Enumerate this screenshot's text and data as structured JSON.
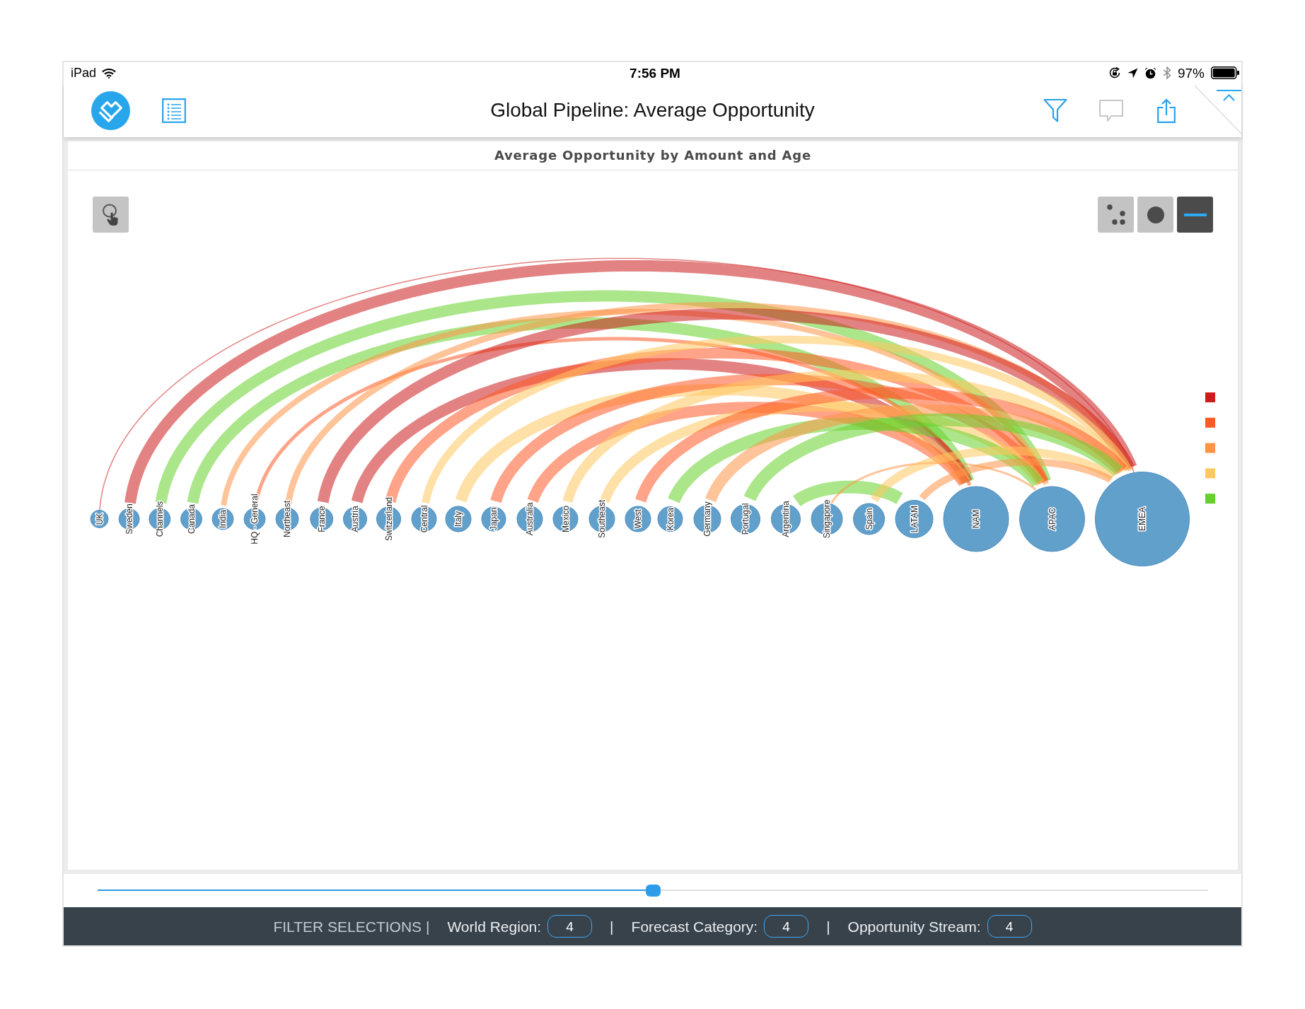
{
  "status_bar": {
    "carrier": "iPad",
    "time": "7:56 PM",
    "battery": "97%"
  },
  "nav_bar": {
    "title": "Global Pipeline: Average Opportunity"
  },
  "panel": {
    "title": "Average Opportunity by Amount and Age"
  },
  "view_modes": [
    {
      "kind": "scatter",
      "selected": false
    },
    {
      "kind": "bubble",
      "selected": false
    },
    {
      "kind": "arc",
      "selected": true
    }
  ],
  "chart": {
    "nodes": [
      {
        "label": "UK"
      },
      {
        "label": "Sweden"
      },
      {
        "label": "Channels"
      },
      {
        "label": "Canada"
      },
      {
        "label": "India"
      },
      {
        "label": "HQ - General"
      },
      {
        "label": "Northeast"
      },
      {
        "label": "France"
      },
      {
        "label": "Austria"
      },
      {
        "label": "Switzerland"
      },
      {
        "label": "Central"
      },
      {
        "label": "Italy"
      },
      {
        "label": "Japan"
      },
      {
        "label": "Australia"
      },
      {
        "label": "Mexico"
      },
      {
        "label": "Southeast"
      },
      {
        "label": "West"
      },
      {
        "label": "Korea"
      },
      {
        "label": "Germany"
      },
      {
        "label": "Portugal"
      },
      {
        "label": "Argentina"
      },
      {
        "label": "Singapore"
      },
      {
        "label": "Spain"
      },
      {
        "label": "LATAM"
      },
      {
        "label": "NAM"
      },
      {
        "label": "APAC"
      },
      {
        "label": "EMEA"
      }
    ]
  },
  "legend": [
    {
      "color": "#cc1c1c"
    },
    {
      "color": "#ff5a26"
    },
    {
      "color": "#ff9447"
    },
    {
      "color": "#ffc75f"
    },
    {
      "color": "#66d12b"
    }
  ],
  "slider": {
    "level": 0.5
  },
  "filter_bar": [
    {
      "kind": "heading",
      "text": "FILTER SELECTIONS |"
    },
    {
      "kind": "filter",
      "label": "World Region:",
      "value": "4"
    },
    {
      "kind": "separator",
      "text": "|"
    },
    {
      "kind": "filter",
      "label": "Forecast Category:",
      "value": "4"
    },
    {
      "kind": "separator",
      "text": "|"
    },
    {
      "kind": "filter",
      "label": "Opportunity Stream:",
      "value": "4"
    }
  ]
}
